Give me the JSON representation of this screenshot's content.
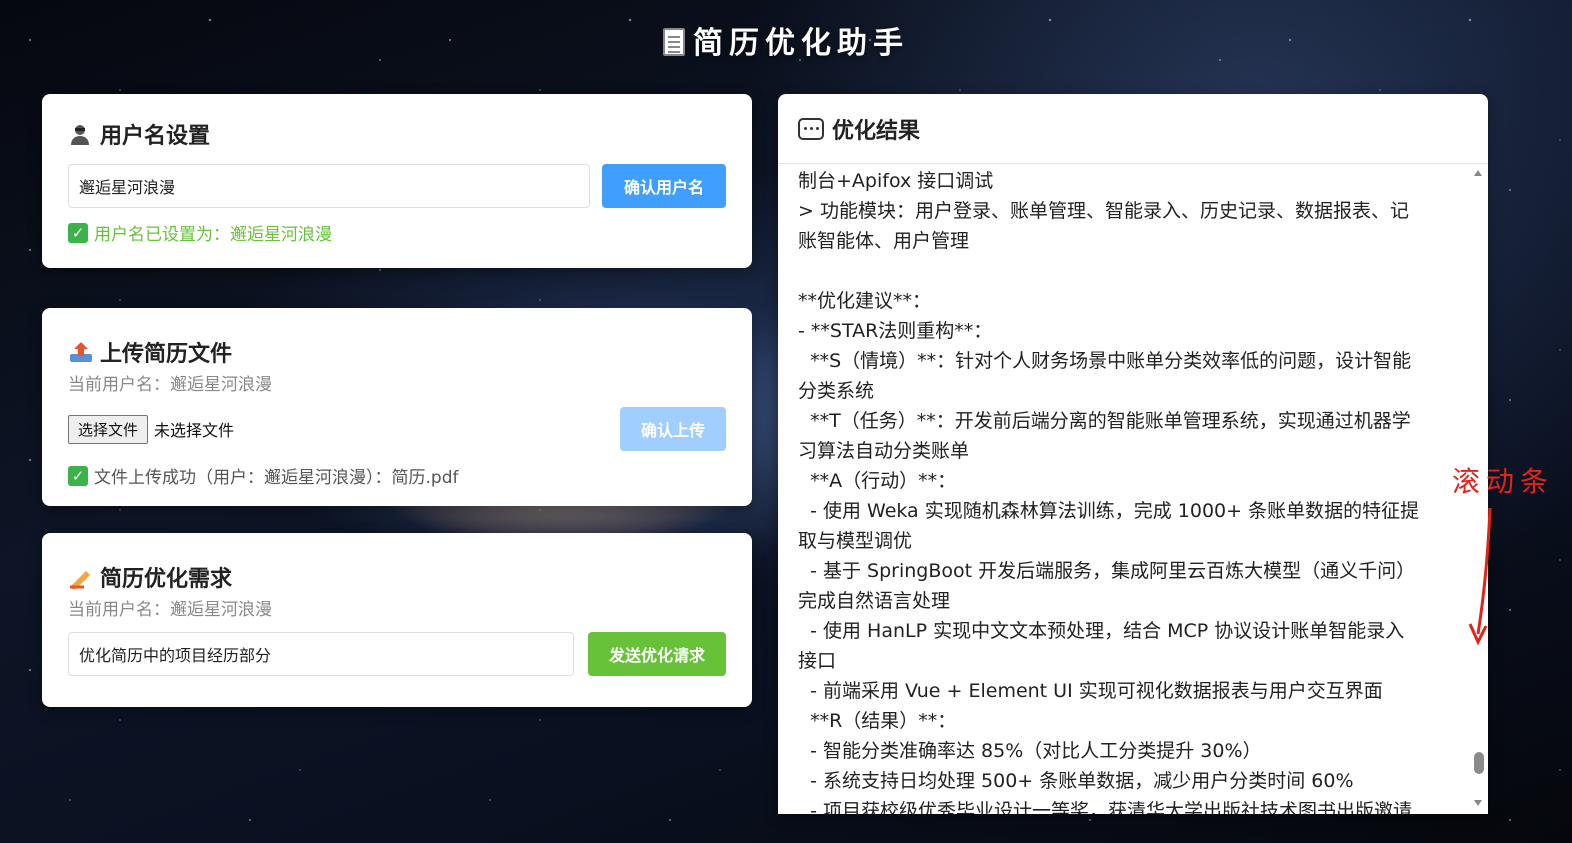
{
  "title": "简历优化助手",
  "username_card": {
    "heading": "用户名设置",
    "input_value": "邂逅星河浪漫",
    "confirm_button": "确认用户名",
    "status": "用户名已设置为：邂逅星河浪漫"
  },
  "upload_card": {
    "heading": "上传简历文件",
    "current_user": "当前用户名：邂逅星河浪漫",
    "choose_file_button": "选择文件",
    "no_file_text": "未选择文件",
    "upload_button": "确认上传",
    "status": "文件上传成功（用户：邂逅星河浪漫）：简历.pdf"
  },
  "request_card": {
    "heading": "简历优化需求",
    "current_user": "当前用户名：邂逅星河浪漫",
    "input_value": "优化简历中的项目经历部分",
    "send_button": "发送优化请求"
  },
  "result_card": {
    "heading": "优化结果",
    "lines": [
      "制台+Apifox 接口调试",
      "> 功能模块：用户登录、账单管理、智能录入、历史记录、数据报表、记",
      "账智能体、用户管理",
      "",
      "**优化建议**：",
      "- **STAR法则重构**：",
      "  **S（情境）**：针对个人财务场景中账单分类效率低的问题，设计智能",
      "分类系统",
      "  **T（任务）**：开发前后端分离的智能账单管理系统，实现通过机器学",
      "习算法自动分类账单",
      "  **A（行动）**：",
      "  - 使用 Weka 实现随机森林算法训练，完成 1000+ 条账单数据的特征提",
      "取与模型调优",
      "  - 基于 SpringBoot 开发后端服务，集成阿里云百炼大模型（通义千问）",
      "完成自然语言处理",
      "  - 使用 HanLP 实现中文文本预处理，结合 MCP 协议设计账单智能录入",
      "接口",
      "  - 前端采用 Vue + Element UI 实现可视化数据报表与用户交互界面",
      "  **R（结果）**：",
      "  - 智能分类准确率达 85%（对比人工分类提升 30%）",
      "  - 系统支持日均处理 500+ 条账单数据，减少用户分类时间 60%",
      "  - 项目获校级优秀毕业设计一等奖，获清华大学出版社技术图书出版邀请"
    ]
  },
  "annotation": "滚动条"
}
